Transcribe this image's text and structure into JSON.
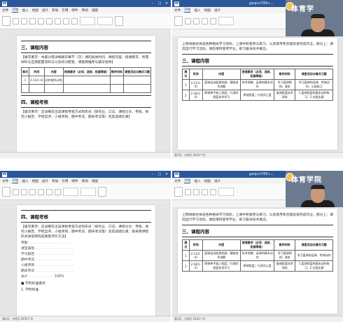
{
  "tl": {
    "menu": [
      "文件",
      "开始",
      "插入",
      "绘图",
      "设计",
      "布局",
      "引用",
      "邮件",
      "审阅",
      "视图"
    ],
    "section_title": "三、课程内容",
    "paragraph": "【填写要求：本部分需详细填写每节（次）课的具体时间、课程内容、授课要求、所需材料与自我配置资料与以及校对配套，课题源推荐与编写指导】",
    "table_headers": [
      "周次",
      "时间",
      "内容",
      "授课要求（必须、选修、拓展等级）",
      "教学材料",
      "课堂活动与情况习题"
    ],
    "row_label": "1",
    "row_date": "2-11(1-4)",
    "row_content": "初步制作计划",
    "section2_title": "四、课程考核",
    "paragraph2": "【填写要求：应详细写出该课程考核方式和形式（如作业、口试、课程论文、考核、探究小报告、学程自评、小组项目、期中考试、期末考试等）及其成绩比重】"
  },
  "tr": {
    "title": "gaojun789+...",
    "teacher_banner": "体育学",
    "intro": "上网将融合体验各种相关学习资料，上课中积极参与练习，认真思考和合理安排完成作业，部分上：课前自行学习活动，课后保持思考学业，练习基本技术概念。",
    "section_title": "三、课程内容",
    "table_headers": [
      "周次",
      "时间",
      "内容",
      "授课要求（必须、选修、拓展等级）",
      "教学材料",
      "课堂活动与情况习题"
    ],
    "rows": [
      {
        "no": "1",
        "date": "2-11(1-4)",
        "content": "篮球运动起源发展；基础战术讲解",
        "req": "技术讲解；运球的基本动作",
        "mat": "学习篮球规则；课本",
        "act": "学习篮球的运球、传球动作；小组练习"
      },
      {
        "no": "2",
        "date": "2-18(1-4)",
        "content": "原地单手肩上投篮；行进间投篮技术学习",
        "req": "原地投篮；行进间上篮",
        "mat": "查阅投篮技术资料",
        "act": "1.篮球投篮的基本动作练习；2.分组比赛"
      }
    ],
    "status": "第3页，共8页 2935个字"
  },
  "bl": {
    "menu": [
      "文件",
      "开始",
      "插入",
      "绘图",
      "设计",
      "布局",
      "引用",
      "邮件",
      "审阅",
      "视图"
    ],
    "section_title": "四、课程考核",
    "paragraph": "【填写要求：应详细写出该课程考核方式和形式（如作业、口试、课程论文、考核、探究小报告、学程自评、小组项目、期中考试、期末考试等）及其成绩比重；如采用课程形式请说明完成质量评价方法】",
    "items": [
      "考勤",
      "课堂表现",
      "学习报告",
      "期中考试",
      "小组项目",
      "期末考试"
    ],
    "total_label": "总计",
    "total_value": "100%",
    "footer_item": "1. 学时标准",
    "footer_bullet": "■ 学时标准要点",
    "status": "第4页，共8页 2935个字"
  },
  "br": {
    "title": "gaojun789+...",
    "teacher_banner": "体育学院",
    "intro": "上网将融合体验各种相关学习资料，上课中积极参与练习，认真思考和合理安排完成作业，部分上：课前自行学习活动，课后保持思考学业，练习基本技术概念。",
    "section_title": "三、课程内容",
    "table_headers": [
      "周次",
      "时间",
      "内容",
      "授课要求（必须、选修、拓展等级）",
      "教学材料",
      "课堂活动与情况习题"
    ],
    "rows": [
      {
        "no": "1",
        "date": "2-11(1-4)",
        "content": "篮球运动起源发展；基础战术讲解",
        "req": "技术讲解；运球的基本动作",
        "mat": "学习篮球规则；课本",
        "act": "学习篮球的运球、传球动作"
      },
      {
        "no": "2",
        "date": "2-18(1-4)",
        "content": "原地单手肩上投篮；行进间投篮技术学习",
        "req": "原地投篮；行进间上篮",
        "mat": "查阅投篮技术资料",
        "act": "1.篮球投篮的基本动作练习；2.分组比赛"
      }
    ],
    "status": "第3页，共8页 2935个字"
  }
}
